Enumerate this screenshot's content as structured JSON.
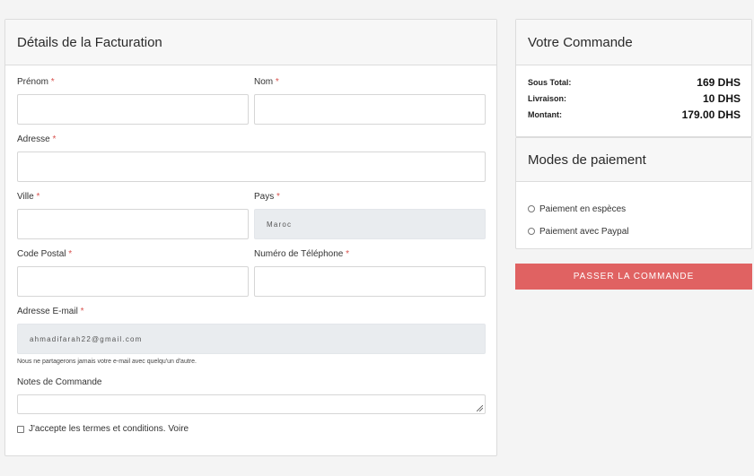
{
  "billing": {
    "title": "Détails de la Facturation",
    "required_mark": "*",
    "first_name": {
      "label": "Prénom",
      "value": ""
    },
    "last_name": {
      "label": "Nom",
      "value": ""
    },
    "address": {
      "label": "Adresse",
      "value": ""
    },
    "city": {
      "label": "Ville",
      "value": ""
    },
    "country": {
      "label": "Pays",
      "value": "Maroc"
    },
    "postal_code": {
      "label": "Code Postal",
      "value": ""
    },
    "phone": {
      "label": "Numéro de Téléphone",
      "value": ""
    },
    "email": {
      "label": "Adresse E-mail",
      "value": "ahmadifarah22@gmail.com",
      "help": "Nous ne partagerons jamais votre e-mail avec quelqu'un d'autre."
    },
    "notes": {
      "label": "Notes de Commande",
      "value": ""
    },
    "terms": {
      "label": "J'accepte les termes et conditions. Voire",
      "checked": false
    }
  },
  "order": {
    "title": "Votre Commande",
    "rows": [
      {
        "label": "Sous Total:",
        "value": "169 DHS"
      },
      {
        "label": "Livraison:",
        "value": "10 DHS"
      },
      {
        "label": "Montant:",
        "value": "179.00 DHS"
      }
    ]
  },
  "payment": {
    "title": "Modes de paiement",
    "options": [
      {
        "label": "Paiement en espèces",
        "selected": false
      },
      {
        "label": "Paiement avec Paypal",
        "selected": false
      }
    ]
  },
  "submit_label": "PASSER LA COMMANDE",
  "colors": {
    "accent": "#e06262",
    "required": "#d9534f",
    "disabled_bg": "#e9ecef"
  }
}
